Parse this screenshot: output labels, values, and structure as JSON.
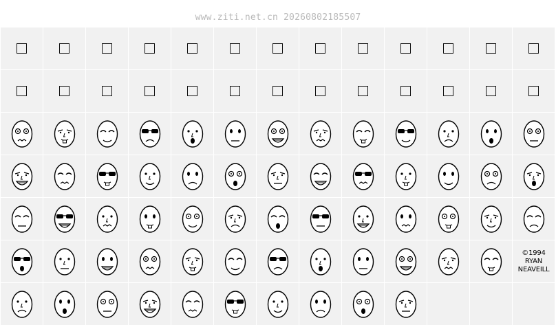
{
  "header": {
    "watermark": "www.ziti.net.cn 20260802185507"
  },
  "grid": {
    "columns": 13,
    "rows": 7,
    "cell_background": "#f1f1f1",
    "glyph_color": "#000000",
    "cells": [
      "tofu",
      "tofu",
      "tofu",
      "tofu",
      "tofu",
      "tofu",
      "tofu",
      "tofu",
      "tofu",
      "tofu",
      "tofu",
      "tofu",
      "tofu",
      "tofu",
      "tofu",
      "tofu",
      "tofu",
      "tofu",
      "tofu",
      "tofu",
      "tofu",
      "tofu",
      "tofu",
      "tofu",
      "tofu",
      "tofu",
      "face-wink-smirk",
      "face-tongue-out",
      "face-glasses-grin",
      "face-smirk",
      "face-stern",
      "face-sunglasses-bucktooth",
      "face-angry-teeth",
      "face-devilish",
      "face-bunny-teeth",
      "face-round-glasses",
      "face-mustache-pain",
      "face-cat-grin",
      "face-goggles-grin",
      "face-neutral-dots",
      "face-gasp",
      "face-v-mouth",
      "face-sad-frown",
      "face-ooh",
      "face-bucktooth",
      "face-worried-frown",
      "face-square-glasses",
      "face-big-grin",
      "face-dizzy-x",
      "face-tongue-wink",
      "face-flat-mouth",
      "face-gleeful",
      "face-grimace",
      "face-bucktooth-smile",
      "face-mustache-glasses",
      "face-long-nose",
      "face-wavy-lips",
      "face-eyepatch",
      "face-sly",
      "face-mustache-frown",
      "face-spiral-eyes",
      "face-open-laugh",
      "face-bored",
      "face-tiny-mouth",
      "face-side-eye",
      "face-frank-glasses",
      "face-scream",
      "face-bowl-cut",
      "face-vampire",
      "face-bald-smile",
      "face-long-face",
      "face-curly-hair",
      "face-sneer",
      "face-pig-nose",
      "face-angry-brow",
      "face-sleepy",
      "face-whistle",
      "credit",
      "face-wide-eyes",
      "face-cyclops",
      "face-teeth-line",
      "face-three-eyes",
      "face-alien-eyes",
      "face-huge-grin",
      "face-goofy",
      "face-monocle-beard",
      "face-wry",
      "face-jackolantern",
      "empty",
      "empty",
      "empty"
    ]
  },
  "credit": {
    "line1": "©1994",
    "line2": "RYAN",
    "line3": "NEAVEILL"
  }
}
